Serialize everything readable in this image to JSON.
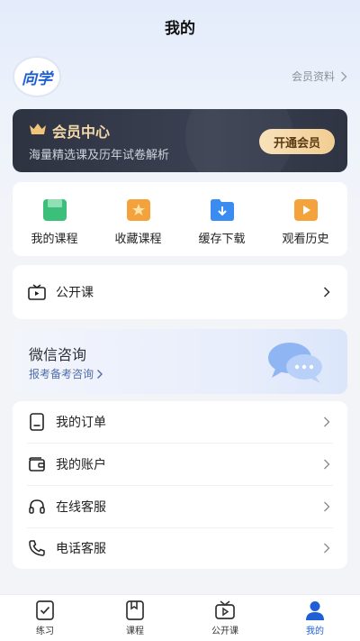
{
  "header": {
    "title": "我的"
  },
  "profile": {
    "avatar_text": "向学",
    "member_info_label": "会员资料"
  },
  "vip": {
    "title": "会员中心",
    "subtitle": "海量精选课及历年试卷解析",
    "button_label": "开通会员",
    "accent": "#f4d9a8"
  },
  "quick_links": [
    {
      "label": "我的课程",
      "icon": "my-course-icon",
      "color": "#3bbf7a"
    },
    {
      "label": "收藏课程",
      "icon": "favorite-course-icon",
      "color": "#f4a23c"
    },
    {
      "label": "缓存下载",
      "icon": "download-cache-icon",
      "color": "#3b8cf0"
    },
    {
      "label": "观看历史",
      "icon": "watch-history-icon",
      "color": "#f4a23c"
    }
  ],
  "open_course": {
    "label": "公开课",
    "icon": "tv-icon"
  },
  "wechat": {
    "title": "微信咨询",
    "subtitle": "报考备考咨询"
  },
  "menu": [
    {
      "label": "我的订单",
      "icon": "order-icon"
    },
    {
      "label": "我的账户",
      "icon": "wallet-icon"
    },
    {
      "label": "在线客服",
      "icon": "headset-icon"
    },
    {
      "label": "电话客服",
      "icon": "phone-icon"
    }
  ],
  "tabs": [
    {
      "label": "练习",
      "icon": "practice-icon"
    },
    {
      "label": "课程",
      "icon": "course-icon"
    },
    {
      "label": "公开课",
      "icon": "open-course-icon"
    },
    {
      "label": "我的",
      "icon": "profile-icon",
      "active": true
    }
  ],
  "colors": {
    "brand": "#1f5fd6",
    "page_bg": "#f2f4f8"
  }
}
